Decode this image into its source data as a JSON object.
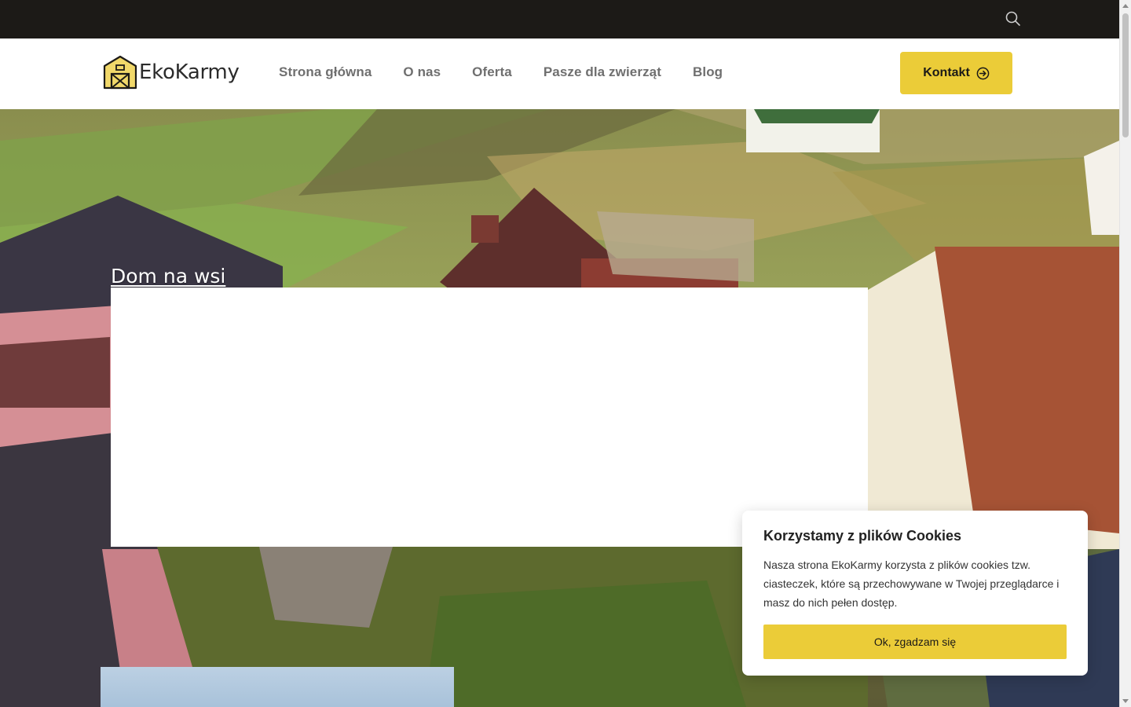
{
  "brand": {
    "name": "EkoKarmy",
    "accent_color": "#ebcc38",
    "dark_color": "#1c1a17"
  },
  "topbar": {
    "search_icon": "search-icon"
  },
  "nav": {
    "items": [
      {
        "label": "Strona główna"
      },
      {
        "label": "O nas"
      },
      {
        "label": "Oferta"
      },
      {
        "label": "Pasze dla zwierząt"
      },
      {
        "label": "Blog"
      }
    ],
    "contact_label": "Kontakt",
    "contact_icon": "arrow-right-circle-icon"
  },
  "hero": {
    "title": "Dom na wsi"
  },
  "cookie": {
    "title": "Korzystamy z plików Cookies",
    "text": "Nasza strona EkoKarmy korzysta z plików cookies tzw. ciasteczek, które są przechowywane w Twojej przeglądarce i masz do nich pełen dostęp.",
    "button": "Ok, zgadzam się"
  }
}
